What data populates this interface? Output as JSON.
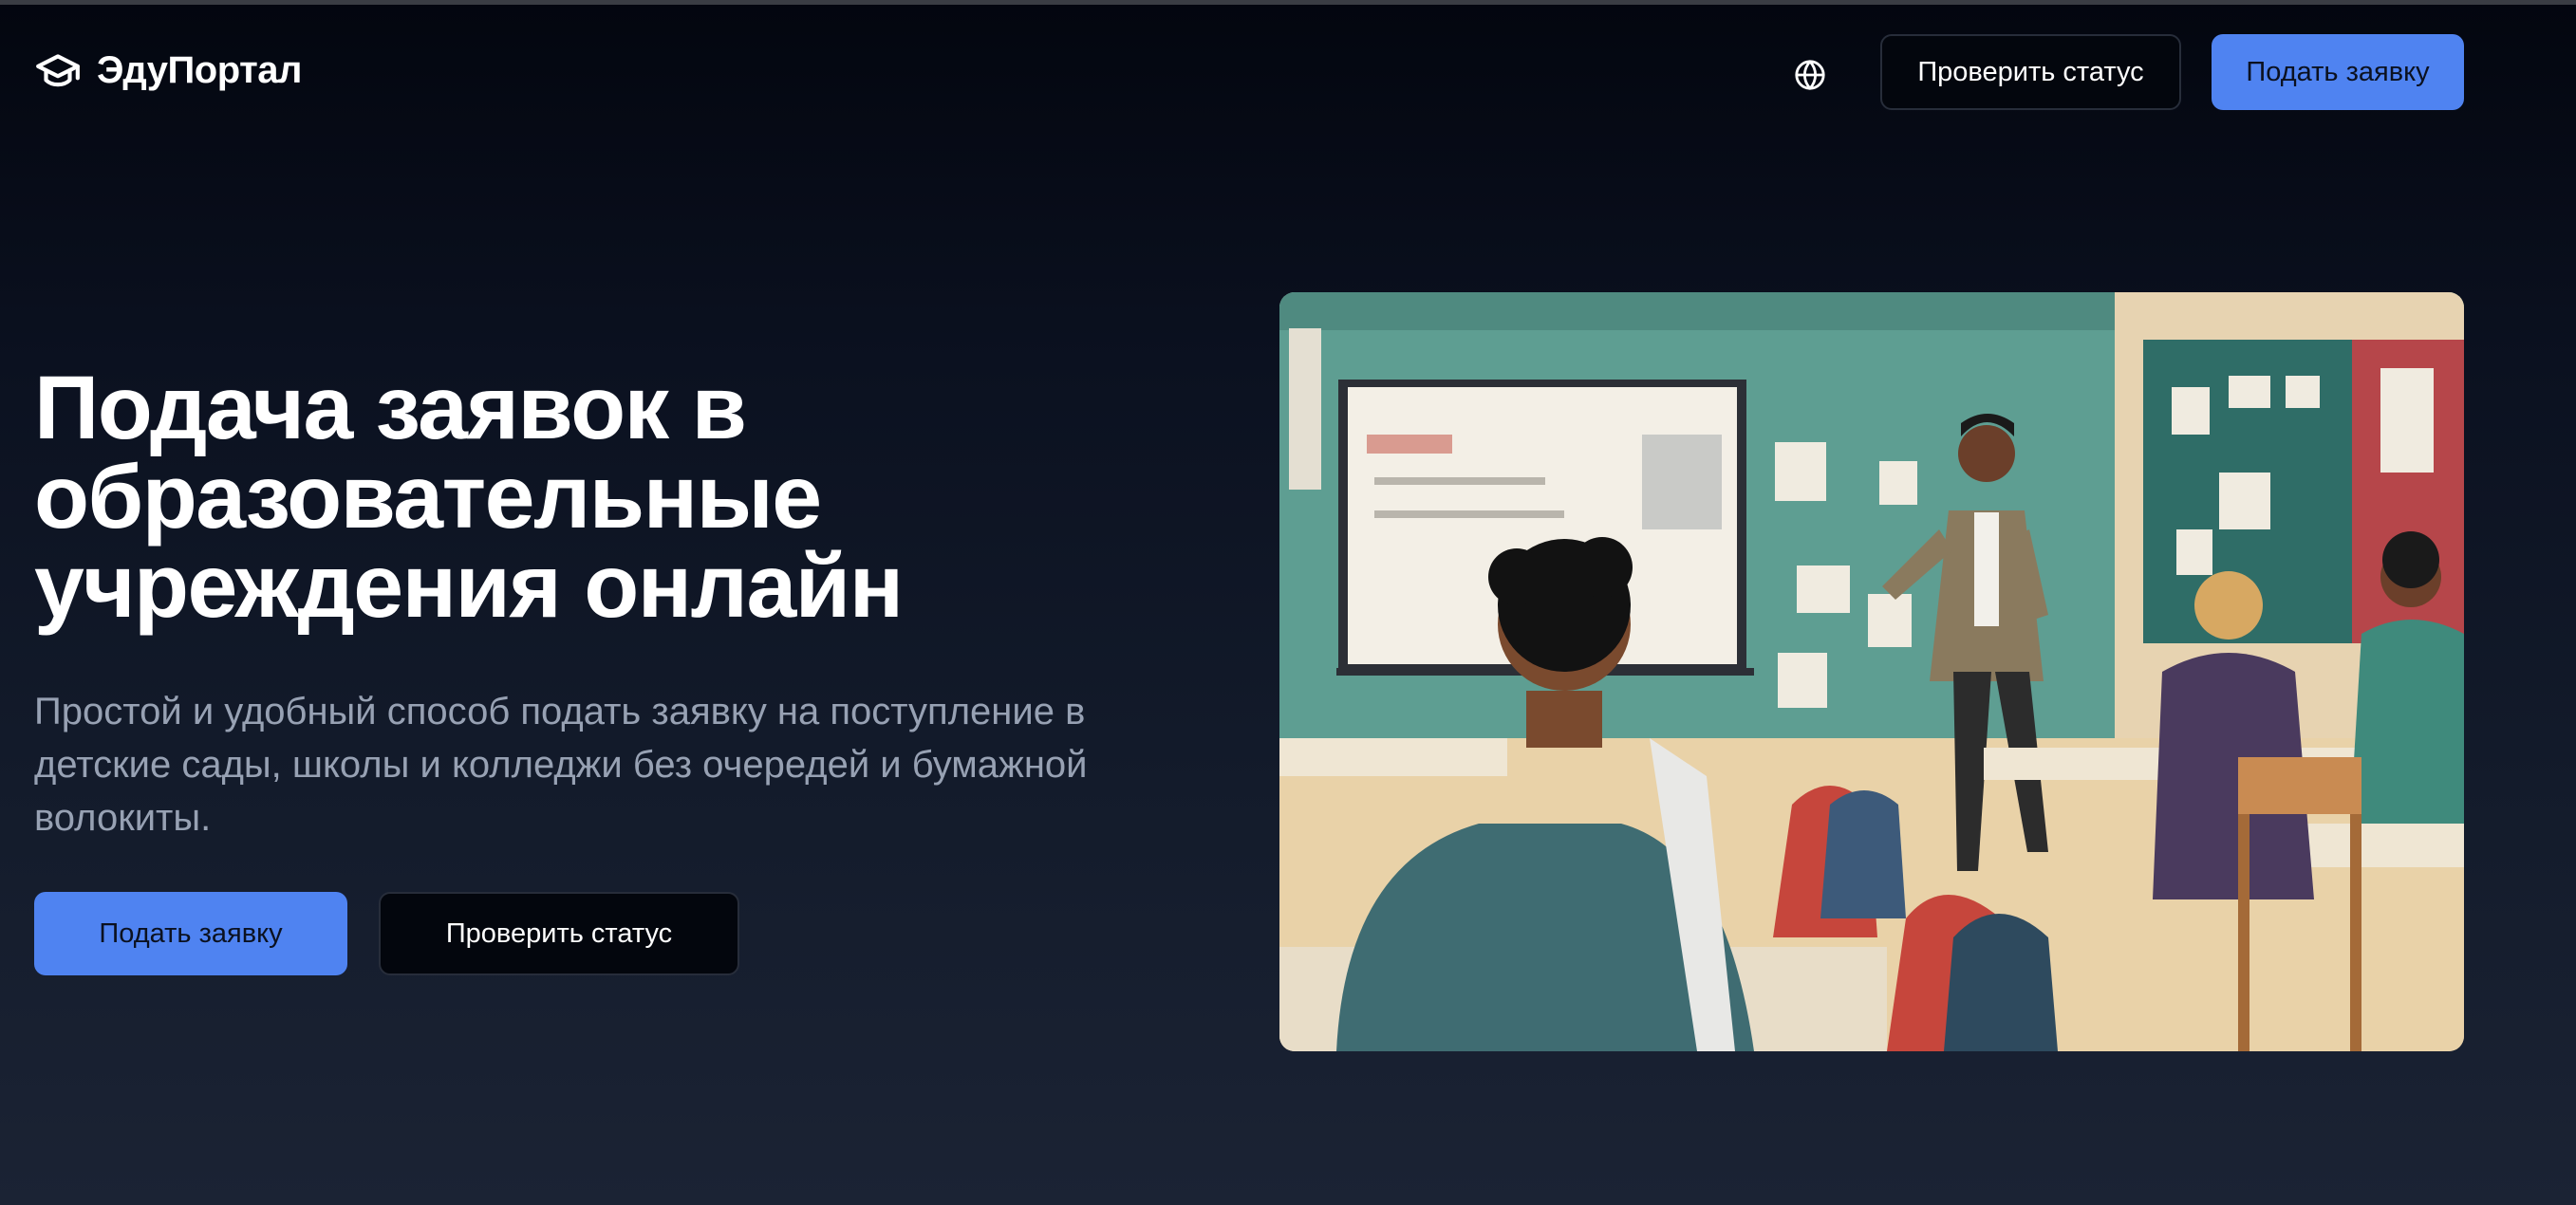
{
  "header": {
    "logo_text": "ЭдуПортал",
    "logo_icon": "graduation-cap-icon",
    "language_icon": "globe-icon",
    "check_status_label": "Проверить статус",
    "apply_label": "Подать заявку"
  },
  "hero": {
    "title": "Подача заявок в образовательные учреждения онлайн",
    "subtitle": "Простой и удобный способ подать заявку на поступление в детские сады, школы и колледжи без очередей и бумажной волокиты.",
    "apply_label": "Подать заявку",
    "check_status_label": "Проверить статус"
  },
  "colors": {
    "accent": "#4f83f1",
    "background_top": "#03060f",
    "background_bottom": "#1b2334",
    "subtitle_text": "#97a1b3"
  }
}
